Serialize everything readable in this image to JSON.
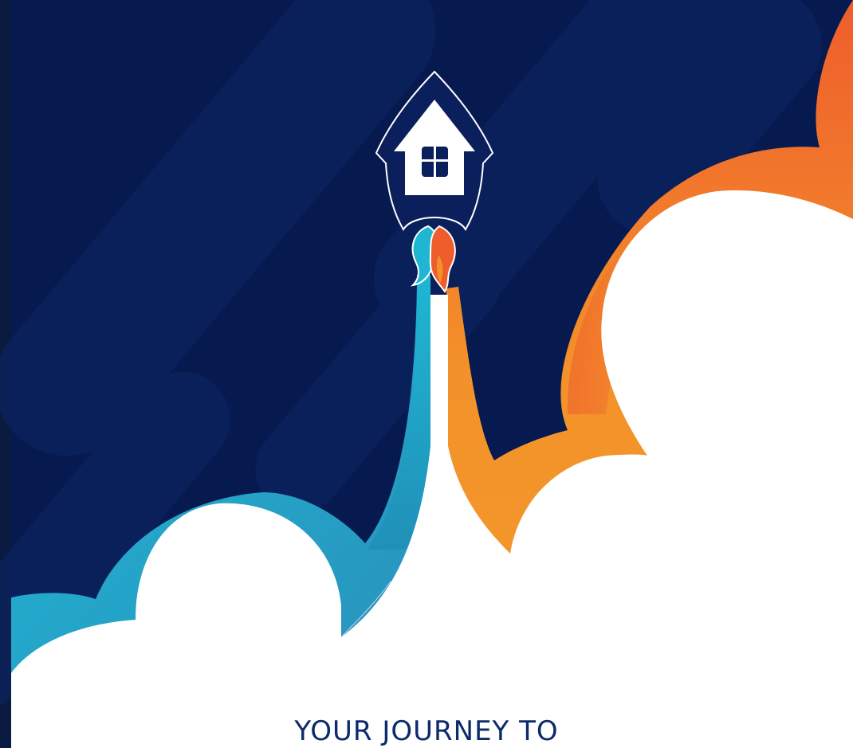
{
  "headline": "YOUR JOURNEY TO",
  "colors": {
    "background": "#071a4f",
    "stripe": "#0e2766",
    "orange": "#f3922a",
    "orange_dark": "#ef5d2d",
    "teal": "#1fb6d4",
    "teal_dark": "#2190b8",
    "cloud": "#ffffff",
    "text": "#0d2a6b"
  },
  "icons": {
    "rocket": "house-rocket-icon",
    "window": "window-icon",
    "flame": "flame-icon"
  }
}
